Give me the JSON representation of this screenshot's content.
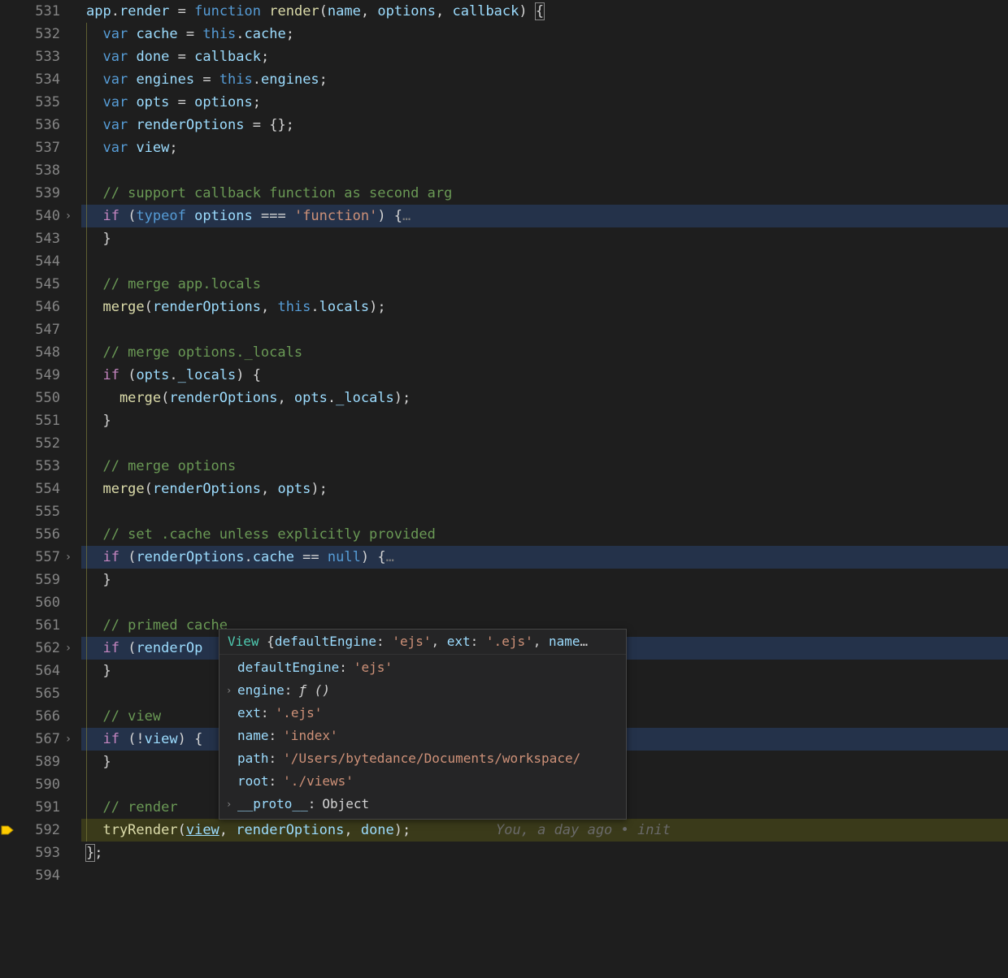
{
  "gutter": {
    "lines": [
      {
        "n": "531",
        "fold": false,
        "bp": false
      },
      {
        "n": "532",
        "fold": false,
        "bp": false
      },
      {
        "n": "533",
        "fold": false,
        "bp": false
      },
      {
        "n": "534",
        "fold": false,
        "bp": false
      },
      {
        "n": "535",
        "fold": false,
        "bp": false
      },
      {
        "n": "536",
        "fold": false,
        "bp": false
      },
      {
        "n": "537",
        "fold": false,
        "bp": false
      },
      {
        "n": "538",
        "fold": false,
        "bp": false
      },
      {
        "n": "539",
        "fold": false,
        "bp": false
      },
      {
        "n": "540",
        "fold": true,
        "bp": false
      },
      {
        "n": "543",
        "fold": false,
        "bp": false
      },
      {
        "n": "544",
        "fold": false,
        "bp": false
      },
      {
        "n": "545",
        "fold": false,
        "bp": false
      },
      {
        "n": "546",
        "fold": false,
        "bp": false
      },
      {
        "n": "547",
        "fold": false,
        "bp": false
      },
      {
        "n": "548",
        "fold": false,
        "bp": false
      },
      {
        "n": "549",
        "fold": false,
        "bp": false
      },
      {
        "n": "550",
        "fold": false,
        "bp": false
      },
      {
        "n": "551",
        "fold": false,
        "bp": false
      },
      {
        "n": "552",
        "fold": false,
        "bp": false
      },
      {
        "n": "553",
        "fold": false,
        "bp": false
      },
      {
        "n": "554",
        "fold": false,
        "bp": false
      },
      {
        "n": "555",
        "fold": false,
        "bp": false
      },
      {
        "n": "556",
        "fold": false,
        "bp": false
      },
      {
        "n": "557",
        "fold": true,
        "bp": false
      },
      {
        "n": "559",
        "fold": false,
        "bp": false
      },
      {
        "n": "560",
        "fold": false,
        "bp": false
      },
      {
        "n": "561",
        "fold": false,
        "bp": false
      },
      {
        "n": "562",
        "fold": true,
        "bp": false
      },
      {
        "n": "564",
        "fold": false,
        "bp": false
      },
      {
        "n": "565",
        "fold": false,
        "bp": false
      },
      {
        "n": "566",
        "fold": false,
        "bp": false
      },
      {
        "n": "567",
        "fold": true,
        "bp": false
      },
      {
        "n": "589",
        "fold": false,
        "bp": false
      },
      {
        "n": "590",
        "fold": false,
        "bp": false
      },
      {
        "n": "591",
        "fold": false,
        "bp": false
      },
      {
        "n": "592",
        "fold": false,
        "bp": true
      },
      {
        "n": "593",
        "fold": false,
        "bp": false
      },
      {
        "n": "594",
        "fold": false,
        "bp": false
      }
    ]
  },
  "code": {
    "lines": [
      {
        "hl": "",
        "tokens": [
          {
            "c": "var",
            "t": "app"
          },
          {
            "c": "op",
            "t": "."
          },
          {
            "c": "prop",
            "t": "render"
          },
          {
            "c": "op",
            "t": " = "
          },
          {
            "c": "kw2",
            "t": "function"
          },
          {
            "c": "op",
            "t": " "
          },
          {
            "c": "fn",
            "t": "render"
          },
          {
            "c": "pn",
            "t": "("
          },
          {
            "c": "var",
            "t": "name"
          },
          {
            "c": "pn",
            "t": ", "
          },
          {
            "c": "var",
            "t": "options"
          },
          {
            "c": "pn",
            "t": ", "
          },
          {
            "c": "var",
            "t": "callback"
          },
          {
            "c": "pn",
            "t": ") "
          },
          {
            "c": "brace-hl",
            "t": "{"
          }
        ]
      },
      {
        "hl": "",
        "indent": 1,
        "tokens": [
          {
            "c": "kw2",
            "t": "  var"
          },
          {
            "c": "op",
            "t": " "
          },
          {
            "c": "var",
            "t": "cache"
          },
          {
            "c": "op",
            "t": " = "
          },
          {
            "c": "this",
            "t": "this"
          },
          {
            "c": "op",
            "t": "."
          },
          {
            "c": "prop",
            "t": "cache"
          },
          {
            "c": "pn",
            "t": ";"
          }
        ]
      },
      {
        "hl": "",
        "indent": 1,
        "tokens": [
          {
            "c": "kw2",
            "t": "  var"
          },
          {
            "c": "op",
            "t": " "
          },
          {
            "c": "var",
            "t": "done"
          },
          {
            "c": "op",
            "t": " = "
          },
          {
            "c": "var",
            "t": "callback"
          },
          {
            "c": "pn",
            "t": ";"
          }
        ]
      },
      {
        "hl": "",
        "indent": 1,
        "tokens": [
          {
            "c": "kw2",
            "t": "  var"
          },
          {
            "c": "op",
            "t": " "
          },
          {
            "c": "var",
            "t": "engines"
          },
          {
            "c": "op",
            "t": " = "
          },
          {
            "c": "this",
            "t": "this"
          },
          {
            "c": "op",
            "t": "."
          },
          {
            "c": "prop",
            "t": "engines"
          },
          {
            "c": "pn",
            "t": ";"
          }
        ]
      },
      {
        "hl": "",
        "indent": 1,
        "tokens": [
          {
            "c": "kw2",
            "t": "  var"
          },
          {
            "c": "op",
            "t": " "
          },
          {
            "c": "var",
            "t": "opts"
          },
          {
            "c": "op",
            "t": " = "
          },
          {
            "c": "var",
            "t": "options"
          },
          {
            "c": "pn",
            "t": ";"
          }
        ]
      },
      {
        "hl": "",
        "indent": 1,
        "tokens": [
          {
            "c": "kw2",
            "t": "  var"
          },
          {
            "c": "op",
            "t": " "
          },
          {
            "c": "var",
            "t": "renderOptions"
          },
          {
            "c": "op",
            "t": " = {};"
          }
        ]
      },
      {
        "hl": "",
        "indent": 1,
        "tokens": [
          {
            "c": "kw2",
            "t": "  var"
          },
          {
            "c": "op",
            "t": " "
          },
          {
            "c": "var",
            "t": "view"
          },
          {
            "c": "pn",
            "t": ";"
          }
        ]
      },
      {
        "hl": "",
        "indent": 1,
        "tokens": []
      },
      {
        "hl": "",
        "indent": 1,
        "tokens": [
          {
            "c": "cmt",
            "t": "  // support callback function as second arg"
          }
        ]
      },
      {
        "hl": "folded-hl",
        "indent": 1,
        "tokens": [
          {
            "c": "ctl",
            "t": "  if"
          },
          {
            "c": "pn",
            "t": " ("
          },
          {
            "c": "kw2",
            "t": "typeof"
          },
          {
            "c": "op",
            "t": " "
          },
          {
            "c": "var",
            "t": "options"
          },
          {
            "c": "op",
            "t": " === "
          },
          {
            "c": "str",
            "t": "'function'"
          },
          {
            "c": "pn",
            "t": ") {"
          },
          {
            "c": "fold",
            "t": "…"
          }
        ]
      },
      {
        "hl": "",
        "indent": 1,
        "tokens": [
          {
            "c": "pn",
            "t": "  }"
          }
        ]
      },
      {
        "hl": "",
        "indent": 1,
        "tokens": []
      },
      {
        "hl": "",
        "indent": 1,
        "tokens": [
          {
            "c": "cmt",
            "t": "  // merge app.locals"
          }
        ]
      },
      {
        "hl": "",
        "indent": 1,
        "tokens": [
          {
            "c": "fn",
            "t": "  merge"
          },
          {
            "c": "pn",
            "t": "("
          },
          {
            "c": "var",
            "t": "renderOptions"
          },
          {
            "c": "pn",
            "t": ", "
          },
          {
            "c": "this",
            "t": "this"
          },
          {
            "c": "op",
            "t": "."
          },
          {
            "c": "prop",
            "t": "locals"
          },
          {
            "c": "pn",
            "t": ");"
          }
        ]
      },
      {
        "hl": "",
        "indent": 1,
        "tokens": []
      },
      {
        "hl": "",
        "indent": 1,
        "tokens": [
          {
            "c": "cmt",
            "t": "  // merge options._locals"
          }
        ]
      },
      {
        "hl": "",
        "indent": 1,
        "tokens": [
          {
            "c": "ctl",
            "t": "  if"
          },
          {
            "c": "pn",
            "t": " ("
          },
          {
            "c": "var",
            "t": "opts"
          },
          {
            "c": "op",
            "t": "."
          },
          {
            "c": "prop",
            "t": "_locals"
          },
          {
            "c": "pn",
            "t": ") {"
          }
        ]
      },
      {
        "hl": "",
        "indent": 1,
        "tokens": [
          {
            "c": "fn",
            "t": "    merge"
          },
          {
            "c": "pn",
            "t": "("
          },
          {
            "c": "var",
            "t": "renderOptions"
          },
          {
            "c": "pn",
            "t": ", "
          },
          {
            "c": "var",
            "t": "opts"
          },
          {
            "c": "op",
            "t": "."
          },
          {
            "c": "prop",
            "t": "_locals"
          },
          {
            "c": "pn",
            "t": ");"
          }
        ]
      },
      {
        "hl": "",
        "indent": 1,
        "tokens": [
          {
            "c": "pn",
            "t": "  }"
          }
        ]
      },
      {
        "hl": "",
        "indent": 1,
        "tokens": []
      },
      {
        "hl": "",
        "indent": 1,
        "tokens": [
          {
            "c": "cmt",
            "t": "  // merge options"
          }
        ]
      },
      {
        "hl": "",
        "indent": 1,
        "tokens": [
          {
            "c": "fn",
            "t": "  merge"
          },
          {
            "c": "pn",
            "t": "("
          },
          {
            "c": "var",
            "t": "renderOptions"
          },
          {
            "c": "pn",
            "t": ", "
          },
          {
            "c": "var",
            "t": "opts"
          },
          {
            "c": "pn",
            "t": ");"
          }
        ]
      },
      {
        "hl": "",
        "indent": 1,
        "tokens": []
      },
      {
        "hl": "",
        "indent": 1,
        "tokens": [
          {
            "c": "cmt",
            "t": "  // set .cache unless explicitly provided"
          }
        ]
      },
      {
        "hl": "folded-hl",
        "indent": 1,
        "tokens": [
          {
            "c": "ctl",
            "t": "  if"
          },
          {
            "c": "pn",
            "t": " ("
          },
          {
            "c": "var",
            "t": "renderOptions"
          },
          {
            "c": "op",
            "t": "."
          },
          {
            "c": "prop",
            "t": "cache"
          },
          {
            "c": "op",
            "t": " == "
          },
          {
            "c": "null",
            "t": "null"
          },
          {
            "c": "pn",
            "t": ") {"
          },
          {
            "c": "fold",
            "t": "…"
          }
        ]
      },
      {
        "hl": "",
        "indent": 1,
        "tokens": [
          {
            "c": "pn",
            "t": "  }"
          }
        ]
      },
      {
        "hl": "",
        "indent": 1,
        "tokens": []
      },
      {
        "hl": "",
        "indent": 1,
        "tokens": [
          {
            "c": "cmt",
            "t": "  // primed cache"
          }
        ]
      },
      {
        "hl": "folded-hl",
        "indent": 1,
        "tokens": [
          {
            "c": "ctl",
            "t": "  if"
          },
          {
            "c": "pn",
            "t": " ("
          },
          {
            "c": "var",
            "t": "renderOp"
          }
        ]
      },
      {
        "hl": "",
        "indent": 1,
        "tokens": [
          {
            "c": "pn",
            "t": "  }"
          }
        ]
      },
      {
        "hl": "",
        "indent": 1,
        "tokens": []
      },
      {
        "hl": "",
        "indent": 1,
        "tokens": [
          {
            "c": "cmt",
            "t": "  // view"
          }
        ]
      },
      {
        "hl": "folded-hl",
        "indent": 1,
        "tokens": [
          {
            "c": "ctl",
            "t": "  if"
          },
          {
            "c": "pn",
            "t": " (!"
          },
          {
            "c": "var",
            "t": "view"
          },
          {
            "c": "pn",
            "t": ") {"
          }
        ]
      },
      {
        "hl": "",
        "indent": 1,
        "tokens": [
          {
            "c": "pn",
            "t": "  }"
          }
        ]
      },
      {
        "hl": "",
        "indent": 1,
        "tokens": []
      },
      {
        "hl": "",
        "indent": 1,
        "tokens": [
          {
            "c": "cmt",
            "t": "  // render"
          }
        ]
      },
      {
        "hl": "current",
        "indent": 1,
        "tokens": [
          {
            "c": "fn",
            "t": "  tryRender"
          },
          {
            "c": "pn",
            "t": "("
          },
          {
            "c": "link",
            "t": "view"
          },
          {
            "c": "pn",
            "t": ", "
          },
          {
            "c": "var",
            "t": "renderOptions"
          },
          {
            "c": "pn",
            "t": ", "
          },
          {
            "c": "var",
            "t": "done"
          },
          {
            "c": "pn",
            "t": ");"
          }
        ],
        "codelens": "You, a day ago • init"
      },
      {
        "hl": "",
        "tokens": [
          {
            "c": "brace-hl",
            "t": "}"
          },
          {
            "c": "pn",
            "t": ";"
          }
        ]
      },
      {
        "hl": "",
        "tokens": []
      }
    ]
  },
  "hover": {
    "header": {
      "type": "View ",
      "rest1": "{",
      "k1": "defaultEngine",
      "v1": "'ejs'",
      "k2": "ext",
      "v2": "'.ejs'",
      "k3": "name",
      "trail": "…"
    },
    "rows": [
      {
        "chev": "",
        "key": "defaultEngine",
        "valType": "str",
        "val": "'ejs'"
      },
      {
        "chev": "›",
        "key": "engine",
        "valType": "fn",
        "val": "ƒ ()"
      },
      {
        "chev": "",
        "key": "ext",
        "valType": "str",
        "val": "'.ejs'"
      },
      {
        "chev": "",
        "key": "name",
        "valType": "str",
        "val": "'index'"
      },
      {
        "chev": "",
        "key": "path",
        "valType": "str",
        "val": "'/Users/bytedance/Documents/workspace/"
      },
      {
        "chev": "",
        "key": "root",
        "valType": "str",
        "val": "'./views'"
      },
      {
        "chev": "›",
        "key": "__proto__",
        "valType": "obj",
        "val": "Object"
      }
    ]
  },
  "glyphs": {
    "fold": "›",
    "fold_ellipsis": "…"
  }
}
